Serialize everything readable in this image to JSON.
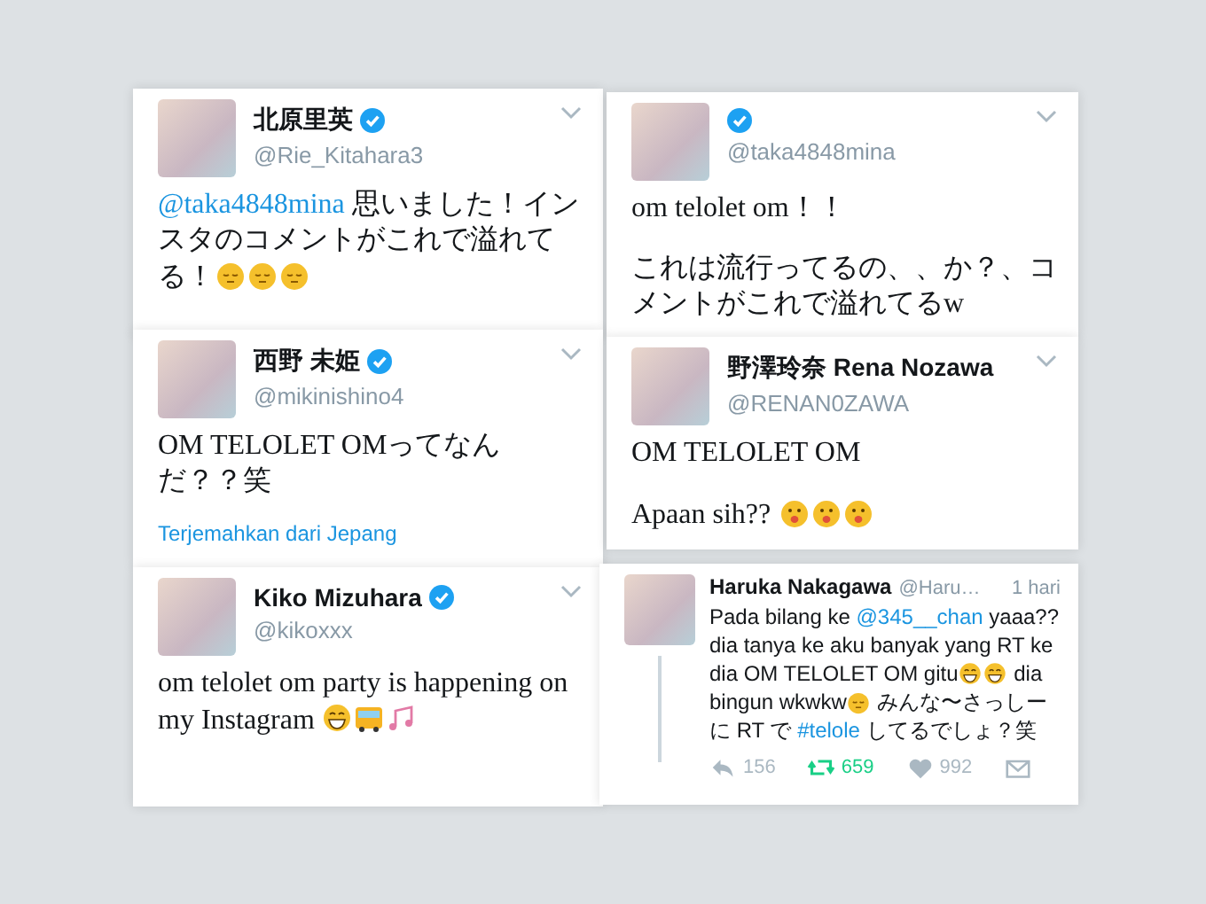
{
  "tweets": [
    {
      "name": "北原里英",
      "verified": true,
      "handle": "@Rie_Kitahara3",
      "body": [
        [
          {
            "kind": "link",
            "text": "@taka4848mina"
          },
          {
            "kind": "text",
            "text": " 思いました！インスタのコメントがこれで溢れてる！"
          },
          {
            "kind": "sleepy"
          },
          {
            "kind": "sleepy"
          },
          {
            "kind": "sleepy"
          }
        ]
      ]
    },
    {
      "verified": true,
      "handle": "@taka4848mina",
      "body": [
        [
          {
            "kind": "text",
            "text": "om telolet om！！"
          }
        ],
        [
          {
            "kind": "text",
            "text": "これは流行ってるの、、か？、コメントがこれで溢れてるw"
          }
        ]
      ]
    },
    {
      "name": "西野 未姫",
      "verified": true,
      "handle": "@mikinishino4",
      "body": [
        [
          {
            "kind": "text",
            "text": "OM TELOLET OMってなんだ？？笑"
          }
        ]
      ],
      "translate": "Terjemahkan dari Jepang"
    },
    {
      "name": "野澤玲奈 Rena Nozawa",
      "handle": "@RENAN0ZAWA",
      "body": [
        [
          {
            "kind": "text",
            "text": "OM TELOLET OM"
          }
        ],
        [
          {
            "kind": "text",
            "text": "Apaan sih?? "
          },
          {
            "kind": "shocked"
          },
          {
            "kind": "shocked"
          },
          {
            "kind": "shocked"
          }
        ]
      ]
    },
    {
      "name": "Kiko Mizuhara",
      "verified": true,
      "handle": "@kikoxxx",
      "body": [
        [
          {
            "kind": "text",
            "text": "om telolet om party is happening on my Instagram "
          },
          {
            "kind": "laugh"
          },
          {
            "kind": "bus"
          },
          {
            "kind": "notes"
          }
        ]
      ]
    },
    {
      "name": "Haruka Nakagawa",
      "handle": "@Haru…",
      "time": "1 hari",
      "body": [
        [
          {
            "kind": "text",
            "text": "Pada bilang ke "
          },
          {
            "kind": "link",
            "text": "@345__chan"
          },
          {
            "kind": "text",
            "text": " yaaa??dia tanya ke aku banyak yang RT ke dia OM TELOLET OM gitu"
          },
          {
            "kind": "laugh"
          },
          {
            "kind": "laugh"
          },
          {
            "kind": "text",
            "text": " dia bingun wkwkw"
          },
          {
            "kind": "sleepy"
          },
          {
            "kind": "text",
            "text": " みんな〜さっしーに RT で "
          },
          {
            "kind": "link",
            "text": "#telole"
          },
          {
            "kind": "text",
            "text": " してるでしょ？笑"
          }
        ]
      ],
      "actions": [
        {
          "kind": "reply",
          "count": "156",
          "active": false
        },
        {
          "kind": "retweet",
          "count": "659",
          "active": true
        },
        {
          "kind": "like",
          "count": "992",
          "active": false
        },
        {
          "kind": "message",
          "active": false
        }
      ]
    }
  ]
}
